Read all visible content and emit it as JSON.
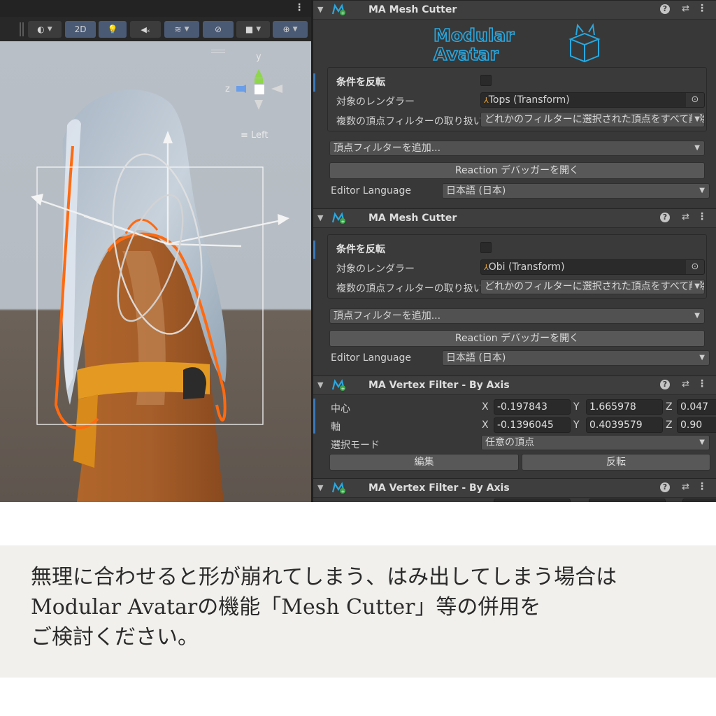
{
  "scene_toolbar": {
    "mode_2d_label": "2D"
  },
  "scene": {
    "orientation": {
      "y_label": "y",
      "z_label": "z",
      "view_label": "≡ Left"
    }
  },
  "components": [
    {
      "title": "MA Mesh Cutter",
      "fields": {
        "invert_label": "条件を反転",
        "invert_checked": false,
        "renderer_label": "対象のレンダラー",
        "renderer_value": "Tops (Transform)",
        "multi_filter_label": "複数の頂点フィルターの取り扱い",
        "multi_filter_value": "どれかのフィルターに選択された頂点をすべて削除"
      },
      "add_filter_value": "頂点フィルターを追加...",
      "reaction_button_label": "Reaction デバッガーを開く",
      "editor_language_label": "Editor Language",
      "editor_language_value": "日本語 (日本)"
    },
    {
      "title": "MA Mesh Cutter",
      "fields": {
        "invert_label": "条件を反転",
        "invert_checked": false,
        "renderer_label": "対象のレンダラー",
        "renderer_value": "Obi (Transform)",
        "multi_filter_label": "複数の頂点フィルターの取り扱い",
        "multi_filter_value": "どれかのフィルターに選択された頂点をすべて削除"
      },
      "add_filter_value": "頂点フィルターを追加...",
      "reaction_button_label": "Reaction デバッガーを開く",
      "editor_language_label": "Editor Language",
      "editor_language_value": "日本語 (日本)"
    },
    {
      "title": "MA Vertex Filter - By Axis",
      "center_label": "中心",
      "center": {
        "x": "-0.197843",
        "y": "1.665978",
        "z": "0.047"
      },
      "axis_label": "軸",
      "axis": {
        "x": "-0.1396045",
        "y": "0.4039579",
        "z": "0.90"
      },
      "selection_mode_label": "選択モード",
      "selection_mode_value": "任意の頂点",
      "edit_button_label": "編集",
      "invert_button_label": "反転"
    },
    {
      "title": "MA Vertex Filter - By Axis"
    }
  ],
  "axis_letters": {
    "x": "X",
    "y": "Y",
    "z": "Z"
  },
  "logo": {
    "line1": "Modular",
    "line2": "Avatar"
  },
  "caption": {
    "line1": "無理に合わせると形が崩れてしまう、はみ出してしまう場合は",
    "line2": "Modular Avatarの機能「Mesh Cutter」等の併用を",
    "line3": "ご検討ください。"
  },
  "colors": {
    "accent_blue": "#3a79bb",
    "logo_blue": "#29a8e0",
    "selection_orange": "#ff6a10"
  }
}
